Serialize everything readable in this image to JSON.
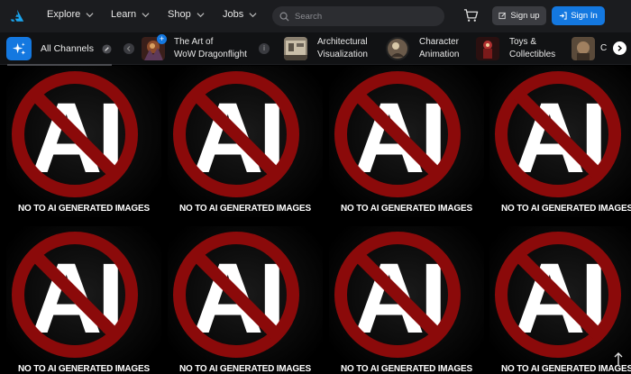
{
  "nav": {
    "explore": "Explore",
    "learn": "Learn",
    "shop": "Shop",
    "jobs": "Jobs",
    "search_placeholder": "Search",
    "signup": "Sign up",
    "signin": "Sign In"
  },
  "channels": {
    "all_label": "All Channels",
    "items": [
      {
        "line1": "The Art of",
        "line2": "WoW Dragonflight"
      },
      {
        "line1": "Architectural",
        "line2": "Visualization"
      },
      {
        "line1": "Character",
        "line2": "Animation"
      },
      {
        "line1": "Toys &",
        "line2": "Collectibles"
      },
      {
        "line1": "C",
        "line2": ""
      }
    ]
  },
  "tiles": {
    "caption": "NO TO AI GENERATED IMAGES",
    "symbol_text": "AI"
  },
  "colors": {
    "accent": "#1478e0",
    "no_sign_red": "#8b0a0a"
  }
}
